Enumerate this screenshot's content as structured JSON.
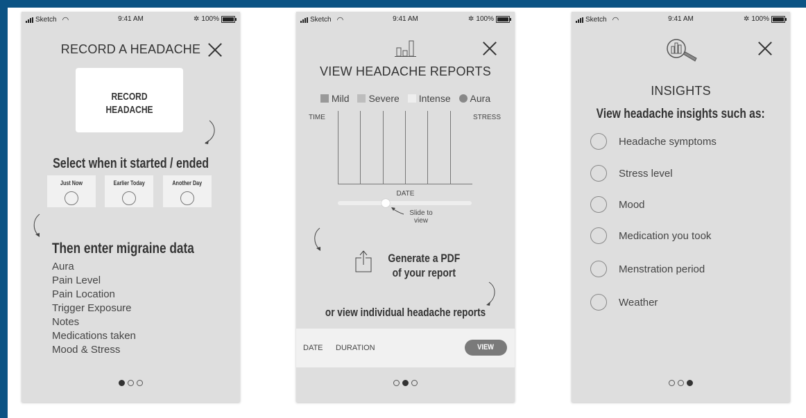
{
  "status_bar": {
    "carrier": "Sketch",
    "time": "9:41 AM",
    "battery": "100%"
  },
  "screen1": {
    "title": "RECORD A HEADACHE",
    "record_button": "RECORD\nHEADACHE",
    "select_heading": "Select when it started / ended",
    "choices": [
      "Just Now",
      "Earlier Today",
      "Another Day"
    ],
    "then_heading": "Then enter migraine data",
    "data_items": [
      "Aura",
      "Pain Level",
      "Pain Location",
      "Trigger Exposure",
      "Notes",
      "Medications taken",
      "Mood & Stress"
    ],
    "active_page": 1
  },
  "screen2": {
    "title": "VIEW HEADACHE REPORTS",
    "legend": [
      {
        "label": "Mild",
        "color": "#999999",
        "shape": "square"
      },
      {
        "label": "Severe",
        "color": "#bdbdbd",
        "shape": "square"
      },
      {
        "label": "Intense",
        "color": "#eeeeee",
        "shape": "square"
      },
      {
        "label": "Aura",
        "color": "#888888",
        "shape": "circle"
      }
    ],
    "chart": {
      "y_left_label": "TIME",
      "y_right_label": "STRESS",
      "x_label": "DATE",
      "columns": 6
    },
    "slider_note": "Slide to\nview",
    "slider_position": 0.36,
    "generate_pdf": "Generate a PDF\nof your report",
    "individual_reports": "or view individual headache reports",
    "report_row": {
      "date": "DATE",
      "duration": "DURATION",
      "view_button": "VIEW"
    },
    "active_page": 2
  },
  "screen3": {
    "title": "INSIGHTS",
    "heading": "View headache insights such as:",
    "items": [
      "Headache symptoms",
      "Stress level",
      "Mood",
      "Medication you took",
      "Menstration period",
      "Weather"
    ],
    "active_page": 3
  },
  "colors": {
    "frame": "#0c5384",
    "phone_bg": "#dedede",
    "card": "#ffffff",
    "button": "#7a7a7a"
  }
}
